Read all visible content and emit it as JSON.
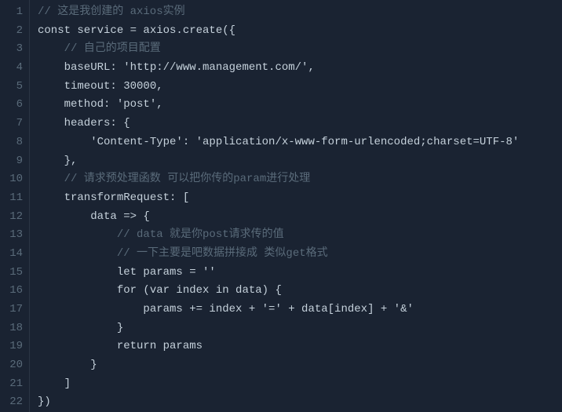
{
  "lines": [
    {
      "n": "1",
      "cls": "c-comment",
      "text": "// 这是我创建的 axios实例"
    },
    {
      "n": "2",
      "cls": "",
      "text": "const service = axios.create({"
    },
    {
      "n": "3",
      "cls": "c-comment",
      "text": "    // 自己的项目配置"
    },
    {
      "n": "4",
      "cls": "",
      "text": "    baseURL: 'http://www.management.com/',"
    },
    {
      "n": "5",
      "cls": "",
      "text": "    timeout: 30000,"
    },
    {
      "n": "6",
      "cls": "",
      "text": "    method: 'post',"
    },
    {
      "n": "7",
      "cls": "",
      "text": "    headers: {"
    },
    {
      "n": "8",
      "cls": "",
      "text": "        'Content-Type': 'application/x-www-form-urlencoded;charset=UTF-8'"
    },
    {
      "n": "9",
      "cls": "",
      "text": "    },"
    },
    {
      "n": "10",
      "cls": "c-comment",
      "text": "    // 请求预处理函数 可以把你传的param进行处理"
    },
    {
      "n": "11",
      "cls": "",
      "text": "    transformRequest: ["
    },
    {
      "n": "12",
      "cls": "",
      "text": "        data => {"
    },
    {
      "n": "13",
      "cls": "c-comment",
      "text": "            // data 就是你post请求传的值"
    },
    {
      "n": "14",
      "cls": "c-comment",
      "text": "            // 一下主要是吧数据拼接成 类似get格式"
    },
    {
      "n": "15",
      "cls": "",
      "text": "            let params = ''"
    },
    {
      "n": "16",
      "cls": "",
      "text": "            for (var index in data) {"
    },
    {
      "n": "17",
      "cls": "",
      "text": "                params += index + '=' + data[index] + '&'"
    },
    {
      "n": "18",
      "cls": "",
      "text": "            }"
    },
    {
      "n": "19",
      "cls": "",
      "text": "            return params"
    },
    {
      "n": "20",
      "cls": "",
      "text": "        }"
    },
    {
      "n": "21",
      "cls": "",
      "text": "    ]"
    },
    {
      "n": "22",
      "cls": "",
      "text": "})"
    }
  ]
}
